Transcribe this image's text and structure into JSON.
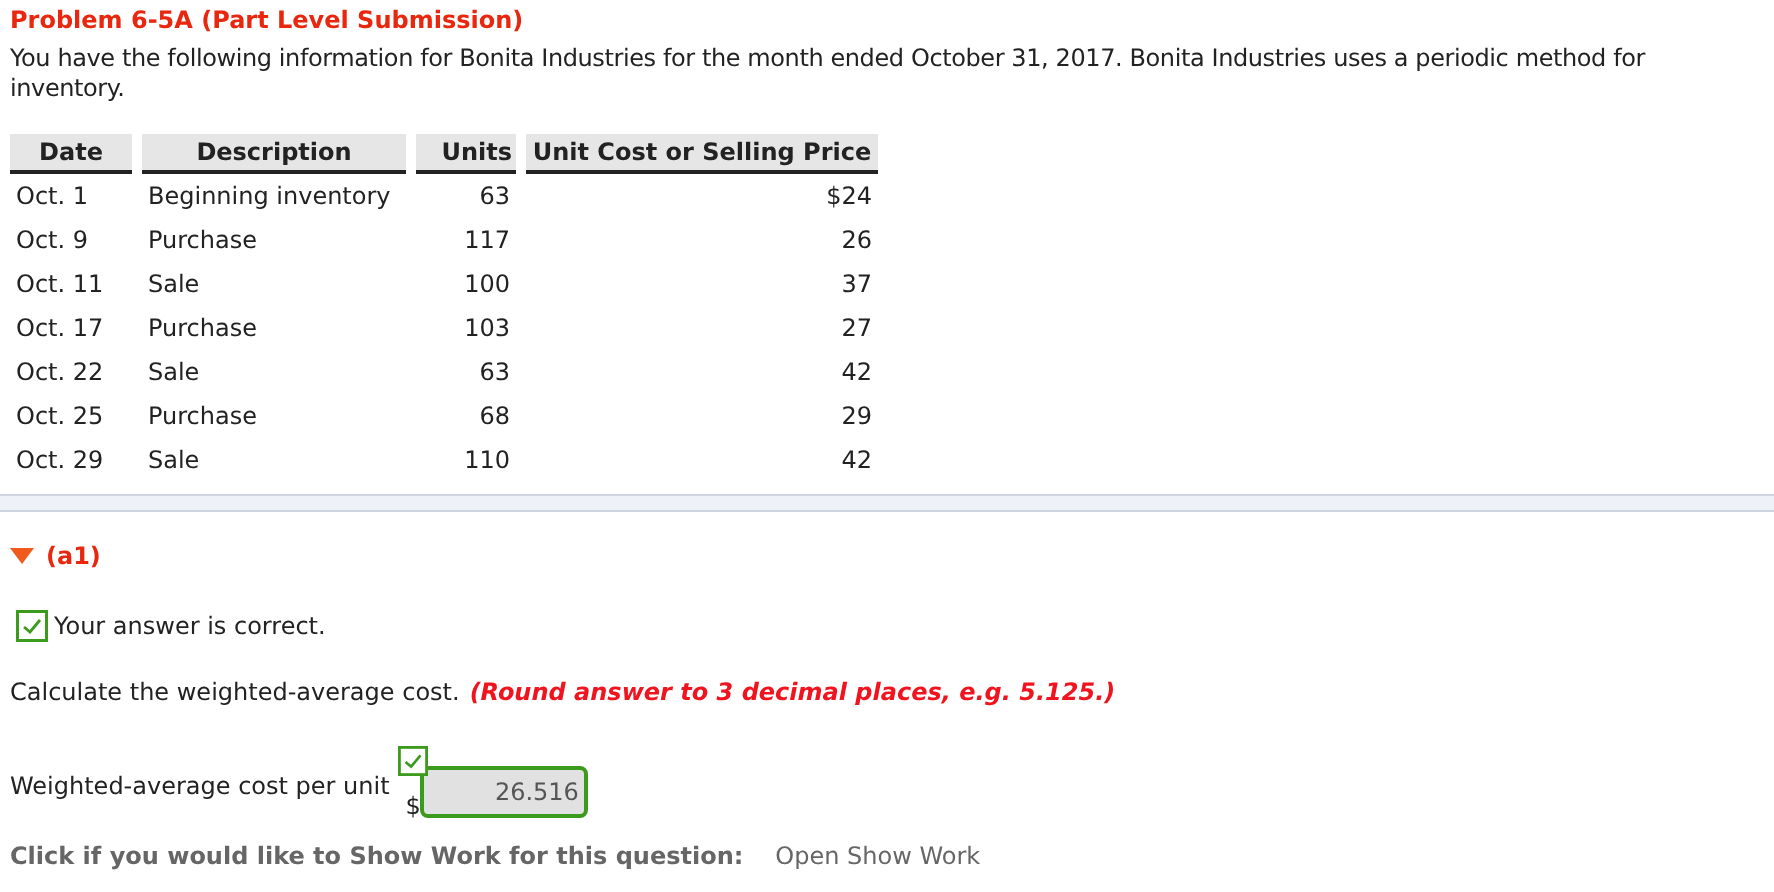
{
  "title": "Problem 6-5A (Part Level Submission)",
  "intro": "You have the following information for Bonita Industries for the month ended October 31, 2017. Bonita Industries uses a periodic method for inventory.",
  "table": {
    "columns": [
      "Date",
      "Description",
      "Units",
      "Unit Cost or Selling Price"
    ],
    "rows": [
      [
        "Oct. 1",
        "Beginning inventory",
        "63",
        "$24"
      ],
      [
        "Oct. 9",
        "Purchase",
        "117",
        "26"
      ],
      [
        "Oct. 11",
        "Sale",
        "100",
        "37"
      ],
      [
        "Oct. 17",
        "Purchase",
        "103",
        "27"
      ],
      [
        "Oct. 22",
        "Sale",
        "63",
        "42"
      ],
      [
        "Oct. 25",
        "Purchase",
        "68",
        "29"
      ],
      [
        "Oct. 29",
        "Sale",
        "110",
        "42"
      ]
    ]
  },
  "part": {
    "label": "(a1)",
    "expanded": true,
    "feedback": {
      "text": "Your answer is correct.",
      "correct": true
    },
    "instruction": "Calculate the weighted-average cost.",
    "hint": "(Round answer to 3 decimal places, e.g. 5.125.)",
    "field": {
      "label": "Weighted-average cost per unit",
      "currency": "$",
      "value": "26.516",
      "correct": true
    },
    "show_work": {
      "prompt": "Click if you would like to Show Work for this question:",
      "link": "Open Show Work"
    }
  }
}
